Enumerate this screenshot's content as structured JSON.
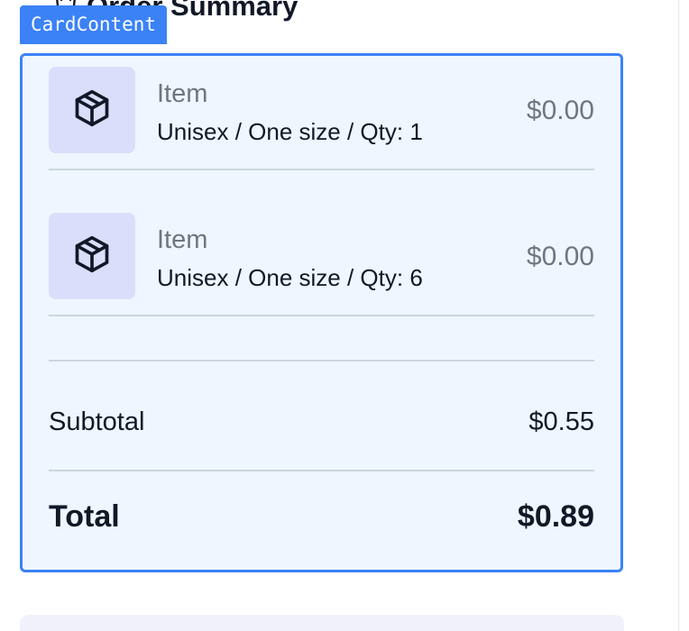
{
  "card": {
    "title": "Order Summary",
    "title_icon": "shopping-bag-icon"
  },
  "debug_tag": "CardContent",
  "items": [
    {
      "icon": "package-icon",
      "name": "Item",
      "meta": "Unisex / One size / Qty: 1",
      "price": "$0.00"
    },
    {
      "icon": "package-icon",
      "name": "Item",
      "meta": "Unisex / One size / Qty: 6",
      "price": "$0.00"
    }
  ],
  "summary": {
    "subtotal_label": "Subtotal",
    "subtotal_value": "$0.55",
    "total_label": "Total",
    "total_value": "$0.89"
  },
  "colors": {
    "highlight_border": "#3b82f6",
    "content_bg": "#eff6ff",
    "thumb_bg": "#dbdefa",
    "muted_text": "#71757e"
  }
}
